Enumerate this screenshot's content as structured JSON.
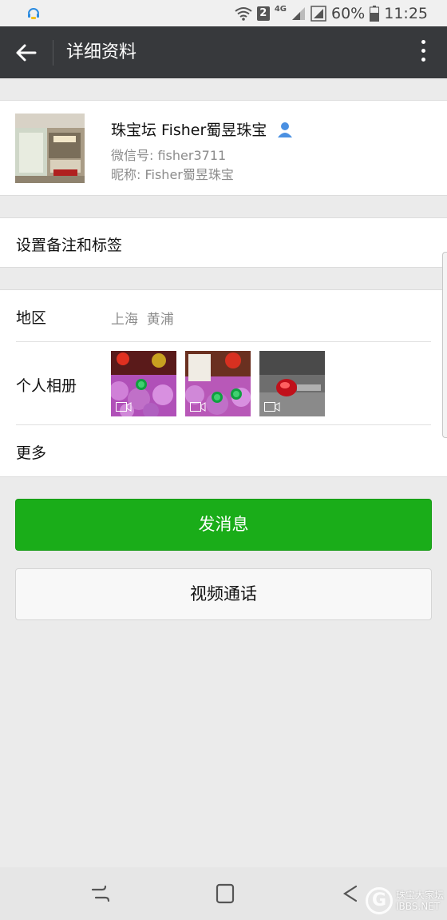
{
  "status_bar": {
    "sim_badge": "2",
    "network": "4G",
    "battery": "60%",
    "time": "11:25"
  },
  "header": {
    "title": "详细资料"
  },
  "profile": {
    "name": "珠宝坛 Fisher蜀昱珠宝",
    "wechat_id": "微信号: fisher3711",
    "nickname": "昵称: Fisher蜀昱珠宝"
  },
  "remark": {
    "label": "设置备注和标签"
  },
  "info": {
    "region_label": "地区",
    "region_value": "上海  黄浦",
    "album_label": "个人相册",
    "more_label": "更多"
  },
  "actions": {
    "send_message": "发消息",
    "video_call": "视频通话"
  },
  "watermark": {
    "line1": "珠宝大家坛",
    "line2": "IBBS.NET"
  },
  "colors": {
    "header_bg": "#37393c",
    "primary_green": "#1aad19",
    "page_bg": "#ebebeb"
  }
}
